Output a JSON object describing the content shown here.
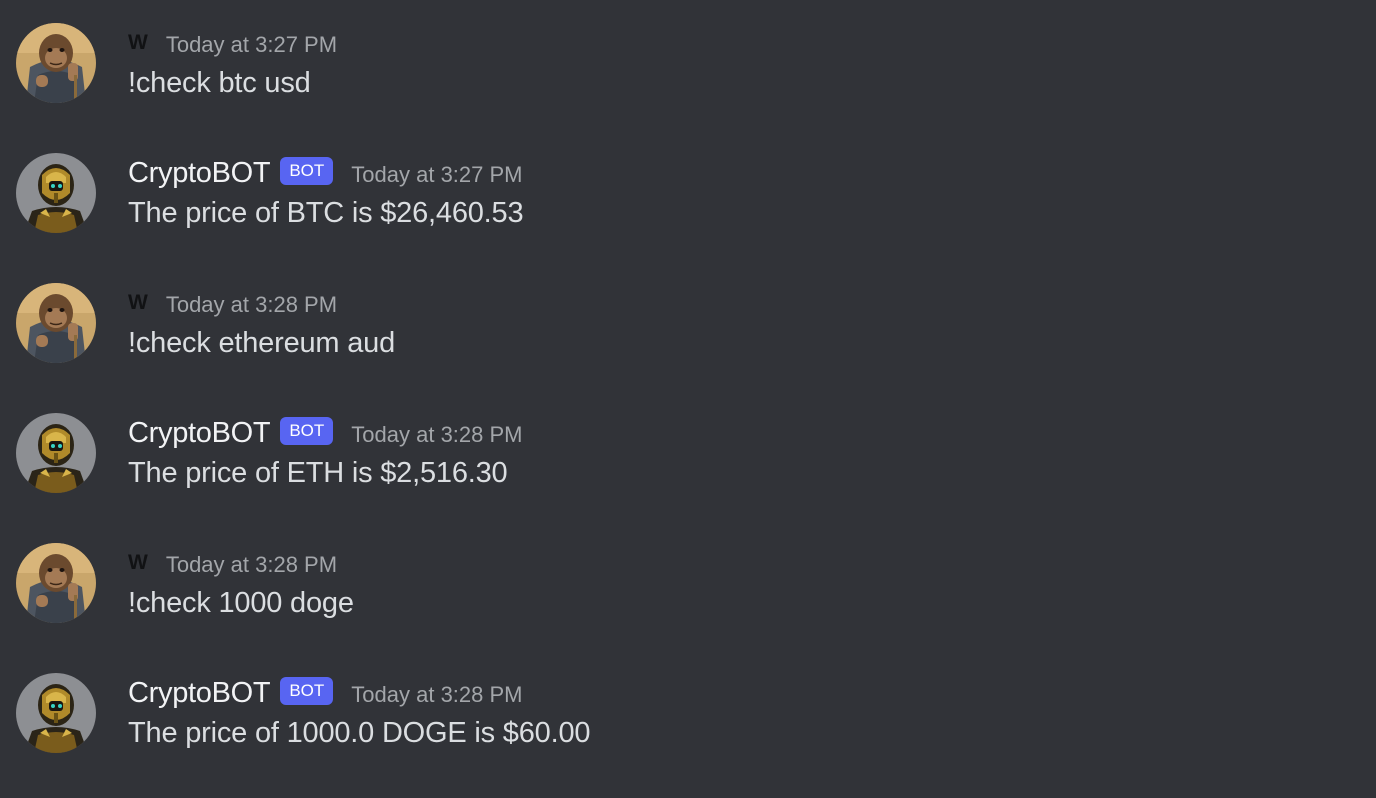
{
  "colors": {
    "background": "#313338",
    "bot_tag": "#5865f2",
    "text": "#dbdee1",
    "timestamp": "#a3a6aa"
  },
  "messages": [
    {
      "author": "W",
      "is_bot": false,
      "avatar_icon": "ape-avatar-icon",
      "timestamp": "Today at 3:27 PM",
      "text": "!check btc usd"
    },
    {
      "author": "CryptoBOT",
      "is_bot": true,
      "bot_tag": "BOT",
      "avatar_icon": "robot-avatar-icon",
      "timestamp": "Today at 3:27 PM",
      "text": "The price of BTC is $26,460.53"
    },
    {
      "author": "W",
      "is_bot": false,
      "avatar_icon": "ape-avatar-icon",
      "timestamp": "Today at 3:28 PM",
      "text": "!check ethereum aud"
    },
    {
      "author": "CryptoBOT",
      "is_bot": true,
      "bot_tag": "BOT",
      "avatar_icon": "robot-avatar-icon",
      "timestamp": "Today at 3:28 PM",
      "text": "The price of ETH is $2,516.30"
    },
    {
      "author": "W",
      "is_bot": false,
      "avatar_icon": "ape-avatar-icon",
      "timestamp": "Today at 3:28 PM",
      "text": "!check 1000 doge"
    },
    {
      "author": "CryptoBOT",
      "is_bot": true,
      "bot_tag": "BOT",
      "avatar_icon": "robot-avatar-icon",
      "timestamp": "Today at 3:28 PM",
      "text": "The price of 1000.0 DOGE is $60.00"
    }
  ]
}
